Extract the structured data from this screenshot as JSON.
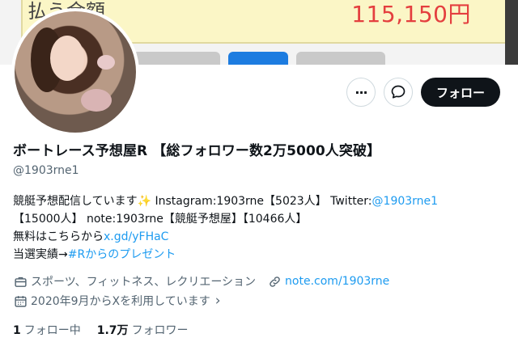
{
  "banner": {
    "label": "払う金額",
    "amount": "115,150円"
  },
  "profile": {
    "display_name": "ボートレース予想屋R 【総フォロワー数2万5000人突破】",
    "handle": "@1903rne1",
    "bio": {
      "line1_text": "競艇予想配信しています",
      "line1_emoji": "✨",
      "line1_rest": " Instagram:1903rne【5023人】 Twitter:",
      "line1_link": "@1903rne1",
      "line2": "【15000人】 note:1903rne【競艇予想屋】【10466人】",
      "line3_text": "無料はこちらから",
      "line3_link": "x.gd/yFHaC",
      "line4_text": "当選実績→",
      "line4_link": "#Rからのプレゼント"
    },
    "category": "スポーツ、フィットネス、レクリエーション",
    "website": "note.com/1903rne",
    "joined": "2020年9月からXを利用しています",
    "joined_chevron": "›",
    "following_count": "1",
    "following_label": "フォロー中",
    "followers_count": "1.7万",
    "followers_label": "フォロワー"
  },
  "actions": {
    "more_label": "···",
    "follow_label": "フォロー"
  },
  "colors": {
    "link": "#1d9bf0",
    "follow_bg": "#0f1419",
    "muted": "#536471"
  }
}
